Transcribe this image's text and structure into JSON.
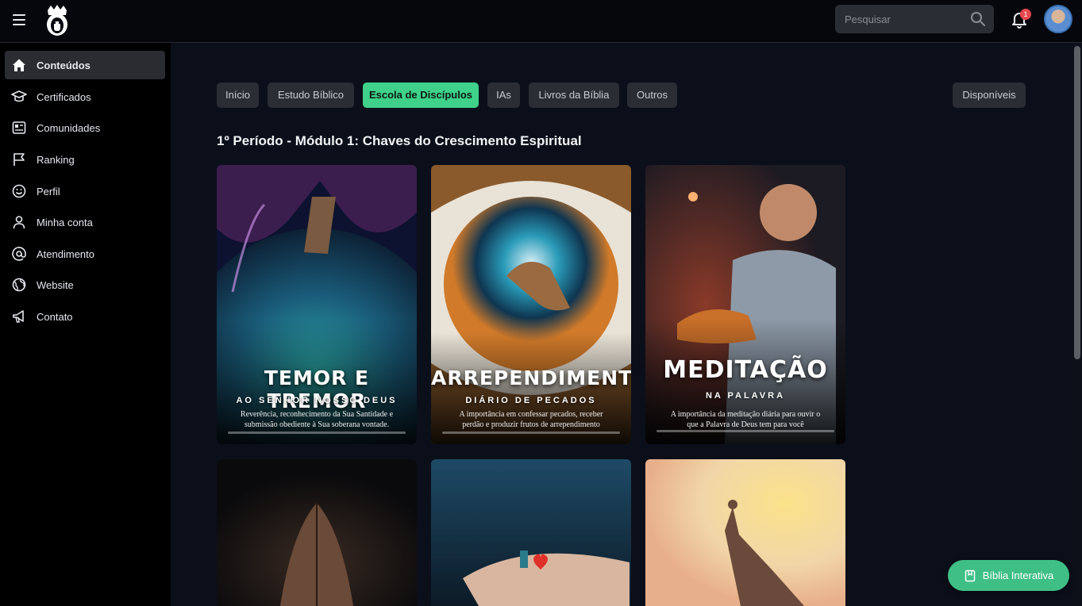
{
  "header": {
    "search_placeholder": "Pesquisar",
    "notification_count": "1"
  },
  "sidebar": {
    "items": [
      {
        "label": "Conteúdos",
        "icon": "home-icon",
        "active": true
      },
      {
        "label": "Certificados",
        "icon": "graduation-cap-icon"
      },
      {
        "label": "Comunidades",
        "icon": "newspaper-icon"
      },
      {
        "label": "Ranking",
        "icon": "flag-icon"
      },
      {
        "label": "Perfil",
        "icon": "smile-icon"
      },
      {
        "label": "Minha conta",
        "icon": "user-icon"
      },
      {
        "label": "Atendimento",
        "icon": "at-sign-icon"
      },
      {
        "label": "Website",
        "icon": "globe-icon"
      },
      {
        "label": "Contato",
        "icon": "megaphone-icon"
      }
    ]
  },
  "tabs": [
    {
      "label": "Início"
    },
    {
      "label": "Estudo Bíblico"
    },
    {
      "label": "Escola de Discípulos",
      "active": true
    },
    {
      "label": "IAs"
    },
    {
      "label": "Livros da Bíblia"
    },
    {
      "label": "Outros"
    }
  ],
  "filter": {
    "label": "Disponíveis"
  },
  "section": {
    "title": "1º Período - Módulo 1: Chaves do Crescimento Espiritual"
  },
  "cards": [
    {
      "title": "TEMOR E TREMOR",
      "subtitle": "AO SENHOR NOSSO DEUS",
      "desc_line1": "Reverência, reconhecimento da Sua Santidade e",
      "desc_line2": "submissão obediente à Sua soberana vontade.",
      "progress": 0
    },
    {
      "title": "ARREPENDIMENTO",
      "subtitle": "DIÁRIO DE PECADOS",
      "desc_line1": "A importância em confessar pecados, receber",
      "desc_line2": "perdão e produzir frutos de arrependimento",
      "progress": 0
    },
    {
      "title": "MEDITAÇÃO",
      "subtitle": "NA PALAVRA",
      "desc_line1": "A importância da meditação diária para ouvir o",
      "desc_line2": "que a Palavra de Deus tem para você",
      "progress": 0
    }
  ],
  "fab": {
    "label": "Bíblia Interativa"
  },
  "colors": {
    "accent": "#3fd18a",
    "background": "#0b0f1a",
    "sidebar": "#000000",
    "badge": "#e5484d"
  }
}
